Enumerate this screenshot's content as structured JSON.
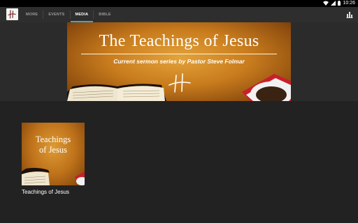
{
  "status_bar": {
    "time": "10:26"
  },
  "app_bar": {
    "tabs": [
      {
        "label": "MORE",
        "active": false
      },
      {
        "label": "EVENTS",
        "active": false
      },
      {
        "label": "MEDIA",
        "active": true
      },
      {
        "label": "BIBLE",
        "active": false
      }
    ],
    "accent_color": "#2fa9de",
    "menu_icon": "bar-chart-icon"
  },
  "banner": {
    "title": "The Teachings of Jesus",
    "subtitle": "Current sermon series by Pastor Steve Folmar"
  },
  "media_items": [
    {
      "thumbnail_title_line1": "Teachings",
      "thumbnail_title_line2": "of Jesus",
      "label": "Teachings of Jesus"
    }
  ]
}
